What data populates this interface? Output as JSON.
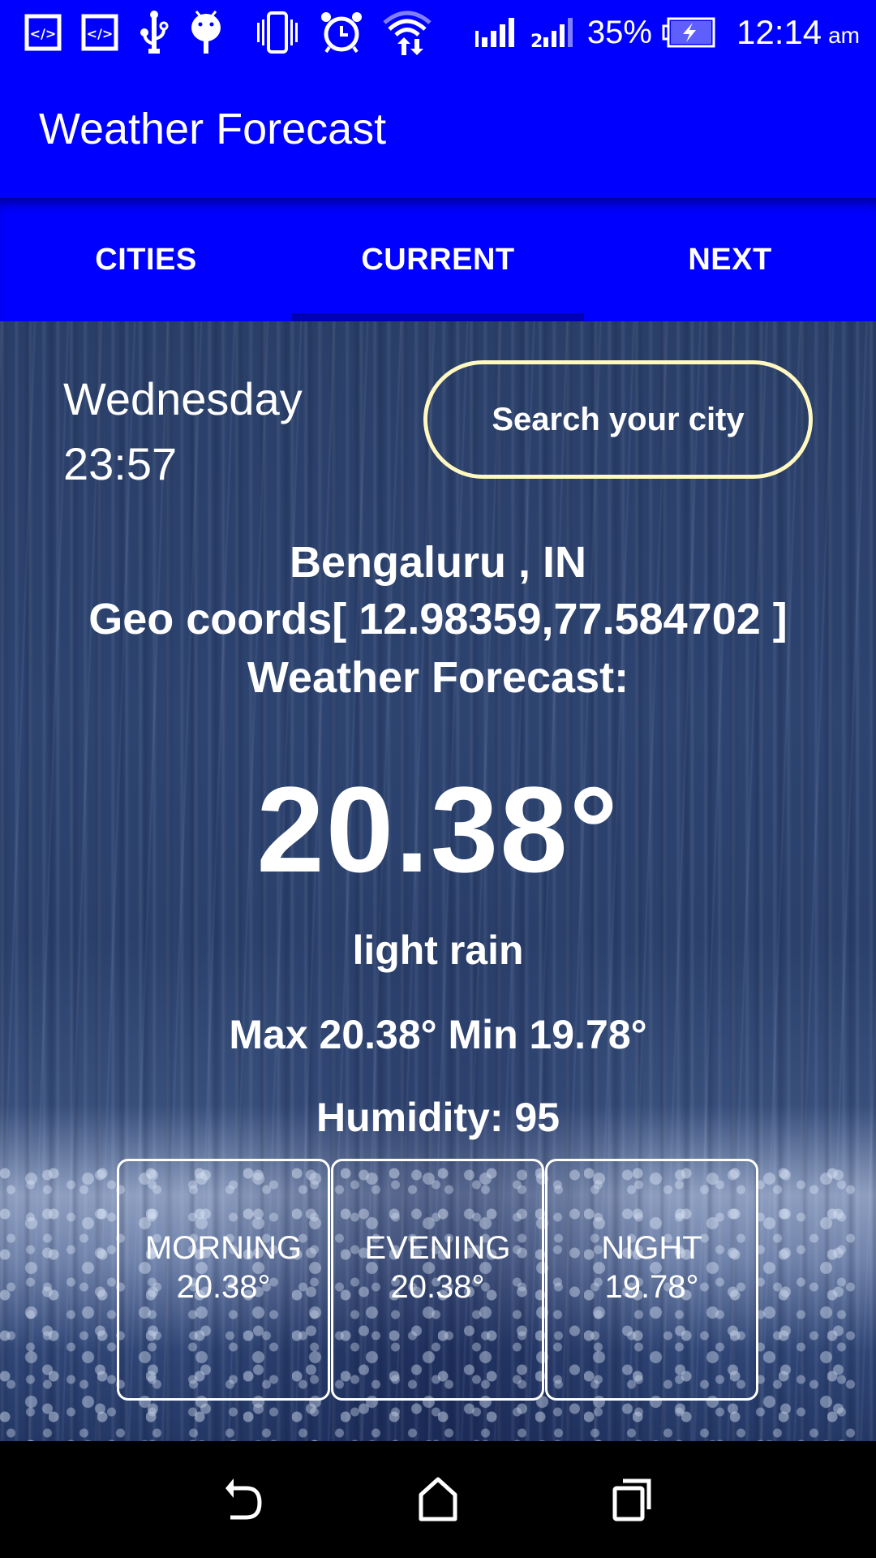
{
  "status_bar": {
    "icons": [
      "developer-mode-icon",
      "developer-mode-icon",
      "usb-icon",
      "android-debug-icon",
      "vibrate-icon",
      "alarm-icon",
      "wifi-data-icon",
      "signal-sim1-icon",
      "signal-sim2-icon",
      "battery-charging-icon"
    ],
    "battery_percent": "35%",
    "time": "12:14",
    "ampm": "am"
  },
  "app_bar": {
    "title": "Weather Forecast",
    "color": "#0000ff"
  },
  "tabs": [
    {
      "label": "CITIES",
      "active": false
    },
    {
      "label": "CURRENT",
      "active": true
    },
    {
      "label": "NEXT",
      "active": false
    }
  ],
  "current": {
    "day": "Wednesday",
    "time": "23:57",
    "search_button": "Search your city",
    "search_border_color": "#fff8c0",
    "city": "Bengaluru , IN",
    "coords": "Geo coords[ 12.98359,77.584702 ]",
    "forecast_label": "Weather Forecast:",
    "temperature": "20.38°",
    "description": "light rain",
    "max_min": "Max 20.38° Min 19.78°",
    "humidity": "Humidity: 95",
    "periods": [
      {
        "label": "MORNING",
        "temp": "20.38°"
      },
      {
        "label": "EVENING",
        "temp": "20.38°"
      },
      {
        "label": "NIGHT",
        "temp": "19.78°"
      }
    ]
  },
  "nav_bar": {
    "buttons": [
      "back-icon",
      "home-icon",
      "recents-icon"
    ]
  }
}
